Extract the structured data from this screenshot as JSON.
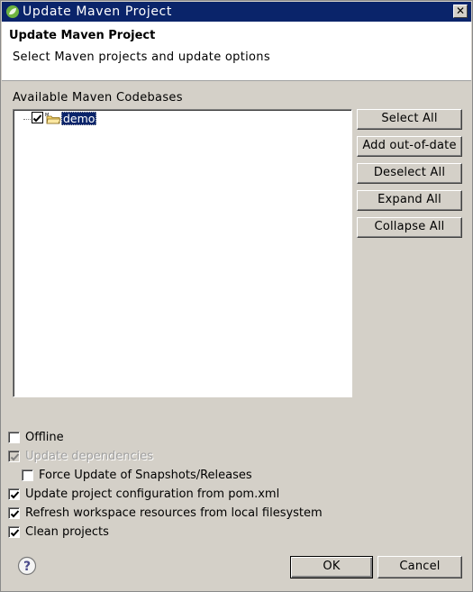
{
  "window": {
    "title": "Update Maven Project"
  },
  "header": {
    "title": "Update Maven Project",
    "message": "Select Maven projects and update options"
  },
  "codebases": {
    "label": "Available Maven Codebases",
    "items": [
      {
        "label": "demo",
        "checked": true,
        "selected": true
      }
    ]
  },
  "side_buttons": {
    "select_all": "Select All",
    "add_out_of_date": "Add out-of-date",
    "deselect_all": "Deselect All",
    "expand_all": "Expand All",
    "collapse_all": "Collapse All"
  },
  "options": {
    "offline": {
      "label": "Offline",
      "checked": false
    },
    "update_dependencies": {
      "label": "Update dependencies",
      "checked": true,
      "disabled": true
    },
    "force_update": {
      "label": "Force Update of Snapshots/Releases",
      "checked": false
    },
    "update_config": {
      "label": "Update project configuration from pom.xml",
      "checked": true
    },
    "refresh_workspace": {
      "label": "Refresh workspace resources from local filesystem",
      "checked": true
    },
    "clean_projects": {
      "label": "Clean projects",
      "checked": true
    }
  },
  "footer": {
    "ok": "OK",
    "cancel": "Cancel"
  },
  "icons": {
    "app": "spring-leaf-icon",
    "close": "close-icon",
    "folder": "maven-project-folder-icon",
    "help": "help-icon"
  },
  "colors": {
    "titlebar": "#0a246a",
    "selection": "#0a246a",
    "dialog_bg": "#d4d0c8"
  }
}
